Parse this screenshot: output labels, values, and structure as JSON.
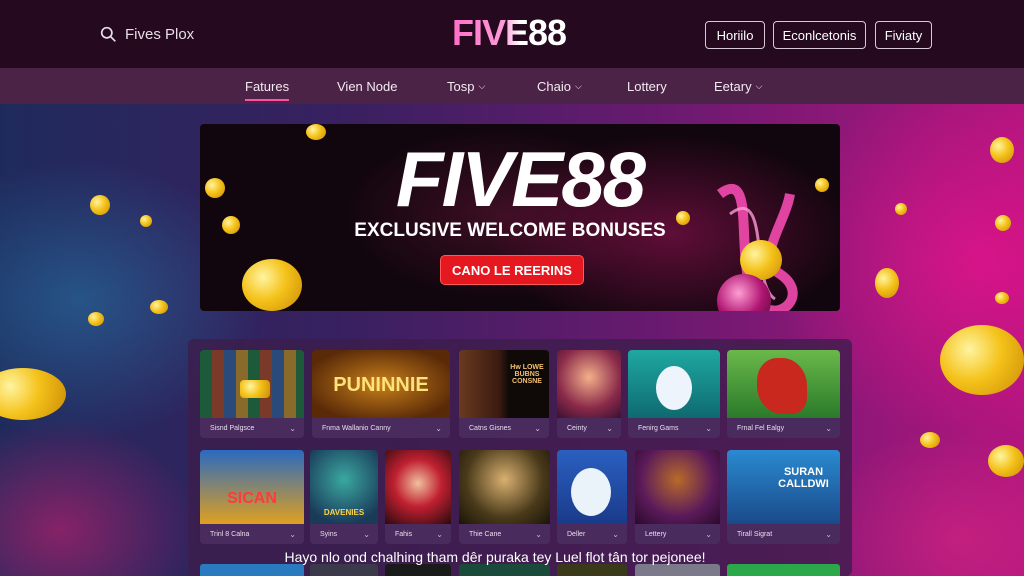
{
  "header": {
    "search_label": "Fives Plox",
    "logo": "FIVE88",
    "buttons": [
      "Horiilo",
      "Econlcetonis",
      "Fiviaty"
    ]
  },
  "nav": {
    "items": [
      {
        "label": "Fatures",
        "active": true,
        "dropdown": false
      },
      {
        "label": "Vien Node",
        "active": false,
        "dropdown": false
      },
      {
        "label": "Tosp",
        "active": false,
        "dropdown": true
      },
      {
        "label": "Chaio",
        "active": false,
        "dropdown": true
      },
      {
        "label": "Lottery",
        "active": false,
        "dropdown": false
      },
      {
        "label": "Eetary",
        "active": false,
        "dropdown": true
      }
    ]
  },
  "banner": {
    "title": "FIVE88",
    "subtitle": "EXCLUSIVE WELCOME BONUSES",
    "cta": "CANO LE REERINS"
  },
  "games": {
    "row1": [
      {
        "label": "Sisnd Palgsce",
        "art": ""
      },
      {
        "label": "Fnma Wallanio Canny",
        "art": "PUNINNIE"
      },
      {
        "label": "Catns Gisnes",
        "art": "Hw LOWE BUBNS CONSNE"
      },
      {
        "label": "Ceinty",
        "art": ""
      },
      {
        "label": "Fenirg Gams",
        "art": ""
      },
      {
        "label": "Frnal Fel Ealgy",
        "art": ""
      }
    ],
    "row2": [
      {
        "label": "Trinl 8 Calna",
        "art": "SICAN"
      },
      {
        "label": "Syins",
        "art": "DAVENIES"
      },
      {
        "label": "Fahis",
        "art": ""
      },
      {
        "label": "Thie Cane",
        "art": ""
      },
      {
        "label": "Deller",
        "art": ""
      },
      {
        "label": "Lettery",
        "art": ""
      },
      {
        "label": "Tirall Sigrat",
        "art": "SURAN CALLDWI"
      }
    ]
  },
  "footer_caption": "Hayo nlo ond chalhing tham dêr puraka tey Luel flot tân tor pejonee!",
  "colors": {
    "accent": "#e5181f",
    "header_bg": "#24091f",
    "nav_bg": "#4b2347",
    "logo_pink": "#ff6fc8"
  },
  "icons": [
    "search-icon",
    "chevron-down-icon"
  ]
}
